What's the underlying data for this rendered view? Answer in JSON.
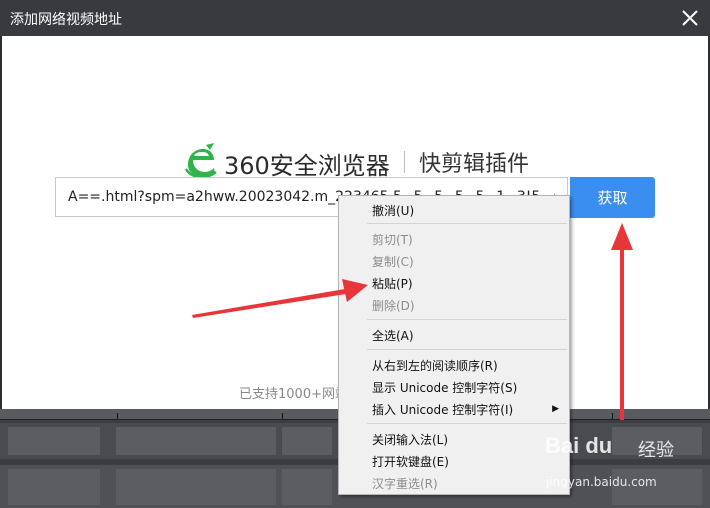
{
  "window": {
    "title": "添加网络视频地址"
  },
  "brand": {
    "name": "360安全浏览器",
    "plugin": "快剪辑插件",
    "logo_icon": "360-browser-e-logo-icon",
    "logo_color": "#2fb34a"
  },
  "url_input": {
    "value": "A==.html?spm=a2hww.20023042.m_223465.5~5~5~5~5~1~3!5~A"
  },
  "fetch_button": {
    "label": "获取",
    "color": "#3a8ef0"
  },
  "support_text": "已支持1000+网站",
  "context_menu": {
    "items": [
      {
        "label": "撤消(U)",
        "enabled": true
      },
      {
        "label": "剪切(T)",
        "enabled": false
      },
      {
        "label": "复制(C)",
        "enabled": false
      },
      {
        "label": "粘贴(P)",
        "enabled": true
      },
      {
        "label": "删除(D)",
        "enabled": false
      },
      {
        "label": "全选(A)",
        "enabled": true
      },
      {
        "label": "从右到左的阅读顺序(R)",
        "enabled": true
      },
      {
        "label": "显示 Unicode 控制字符(S)",
        "enabled": true
      },
      {
        "label": "插入 Unicode 控制字符(I)",
        "enabled": true,
        "submenu": true
      },
      {
        "label": "关闭输入法(L)",
        "enabled": true
      },
      {
        "label": "打开软键盘(E)",
        "enabled": true
      },
      {
        "label": "汉字重选(R)",
        "enabled": false
      }
    ]
  },
  "annotations": {
    "arrow_color": "#e8353a"
  },
  "watermark": {
    "brand": "Bai du",
    "jingyan": "经验",
    "url": "jingyan.baidu.com"
  }
}
